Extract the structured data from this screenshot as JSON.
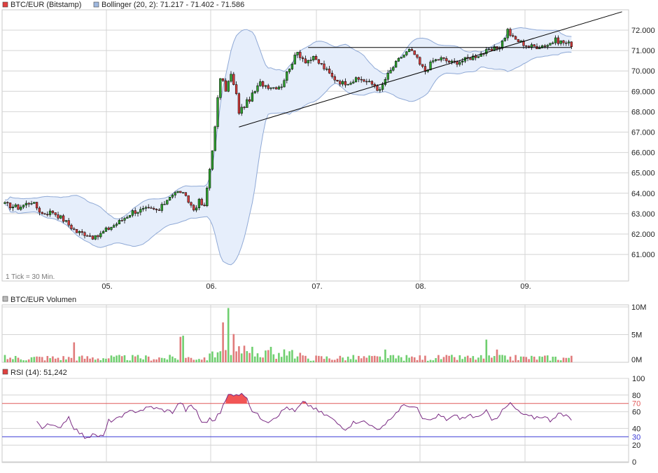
{
  "colors": {
    "price_swatch": "#e0403f",
    "bollinger_swatch": "#9fb8df",
    "bollinger_fill": "#e6eefb",
    "bollinger_line": "#8fa9d6",
    "candle_up": "#2ea02e",
    "candle_down": "#d23b3b",
    "candle_outline": "#000000",
    "volume_swatch": "#bbbbbb",
    "volume_up": "#6fcf6f",
    "volume_down": "#e07b7b",
    "rsi_swatch": "#e0403f",
    "rsi_line": "#7a2a83",
    "rsi_over70": "#f25555",
    "rsi_upper": "#e05a5a",
    "rsi_lower": "#3b3bd6",
    "grid": "#d4d4d4",
    "axis_text": "#222222",
    "trendline": "#000000"
  },
  "price_panel": {
    "legend": [
      {
        "label": "BTC/EUR (Bitstamp)",
        "swatch": "red"
      },
      {
        "label": "Bollinger (20, 2): 71.217 - 71.402 - 71.586",
        "swatch": "blue"
      }
    ],
    "footnote": "1 Tick = 30 Min."
  },
  "volume_panel": {
    "legend": "BTC/EUR Volumen"
  },
  "rsi_panel": {
    "legend": "RSI (14): 51,242"
  },
  "chart_data": [
    {
      "type": "candlestick",
      "title": "BTC/EUR (Bitstamp)",
      "x_ticks": [
        "05.",
        "06.",
        "07.",
        "08.",
        "09."
      ],
      "ylim": [
        60000,
        72700
      ],
      "y_ticks": [
        "61.000",
        "62.000",
        "63.000",
        "64.000",
        "65.000",
        "66.000",
        "67.000",
        "68.000",
        "69.000",
        "70.000",
        "71.000",
        "72.000"
      ],
      "grid": true,
      "close_keypoints": [
        [
          0,
          63450
        ],
        [
          5,
          63300
        ],
        [
          10,
          63600
        ],
        [
          14,
          63000
        ],
        [
          18,
          63100
        ],
        [
          22,
          62700
        ],
        [
          27,
          62100
        ],
        [
          31,
          62000
        ],
        [
          34,
          61800
        ],
        [
          38,
          62200
        ],
        [
          43,
          62600
        ],
        [
          48,
          63100
        ],
        [
          53,
          63200
        ],
        [
          58,
          63150
        ],
        [
          62,
          63900
        ],
        [
          66,
          64100
        ],
        [
          69,
          63600
        ],
        [
          71,
          63200
        ],
        [
          73,
          63600
        ],
        [
          75,
          63300
        ],
        [
          77,
          65200
        ],
        [
          79,
          67200
        ],
        [
          80,
          68600
        ],
        [
          81,
          69700
        ],
        [
          83,
          69100
        ],
        [
          85,
          69800
        ],
        [
          87,
          68800
        ],
        [
          88,
          68000
        ],
        [
          90,
          68300
        ],
        [
          93,
          68800
        ],
        [
          96,
          69400
        ],
        [
          98,
          69300
        ],
        [
          101,
          69200
        ],
        [
          104,
          69300
        ],
        [
          107,
          70200
        ],
        [
          110,
          70900
        ],
        [
          113,
          70500
        ],
        [
          116,
          70600
        ],
        [
          119,
          70300
        ],
        [
          123,
          69700
        ],
        [
          127,
          69400
        ],
        [
          130,
          69500
        ],
        [
          134,
          69600
        ],
        [
          137,
          69400
        ],
        [
          139,
          69300
        ],
        [
          141,
          69000
        ],
        [
          143,
          69600
        ],
        [
          146,
          70200
        ],
        [
          149,
          70700
        ],
        [
          152,
          71000
        ],
        [
          154,
          70800
        ],
        [
          156,
          70300
        ],
        [
          158,
          70000
        ],
        [
          161,
          70500
        ],
        [
          164,
          70600
        ],
        [
          168,
          70400
        ],
        [
          172,
          70500
        ],
        [
          176,
          70700
        ],
        [
          180,
          70900
        ],
        [
          183,
          71000
        ],
        [
          186,
          71200
        ],
        [
          188,
          71700
        ],
        [
          189,
          72000
        ],
        [
          191,
          71600
        ],
        [
          194,
          71400
        ],
        [
          197,
          71200
        ],
        [
          200,
          71200
        ],
        [
          204,
          71300
        ],
        [
          207,
          71500
        ],
        [
          210,
          71400
        ],
        [
          213,
          71300
        ]
      ],
      "series": [
        {
          "name": "BTC/EUR (Bitstamp)",
          "style": "candlestick"
        },
        {
          "name": "Bollinger (20, 2)",
          "values_last": [
            71.217,
            71.402,
            71.586
          ]
        }
      ],
      "annotations": {
        "resistance_line": {
          "y": 71150,
          "x_from": 114,
          "x_to": 213
        },
        "rising_trendline": {
          "from": [
            88,
            67250
          ],
          "to": [
            232,
            72900
          ]
        }
      }
    },
    {
      "type": "bar",
      "title": "BTC/EUR Volumen",
      "ylim": [
        0,
        10000000
      ],
      "y_ticks": [
        "10M",
        "5M",
        "0M"
      ],
      "spikes": [
        [
          26,
          3600000
        ],
        [
          66,
          4600000
        ],
        [
          67,
          4800000
        ],
        [
          82,
          7200000
        ],
        [
          84,
          9800000
        ],
        [
          86,
          5100000
        ],
        [
          88,
          2900000
        ],
        [
          90,
          3000000
        ],
        [
          93,
          2800000
        ],
        [
          99,
          2200000
        ],
        [
          143,
          2300000
        ],
        [
          181,
          4100000
        ],
        [
          185,
          2300000
        ]
      ]
    },
    {
      "type": "line",
      "title": "RSI (14)",
      "last_value": "51,242",
      "ylim": [
        0,
        100
      ],
      "y_ticks": [
        "0",
        "20",
        "40",
        "60",
        "80",
        "100"
      ],
      "bands": {
        "upper": 70,
        "lower": 30
      },
      "band_labels": [
        "70",
        "30"
      ],
      "keypoints": [
        [
          12,
          49
        ],
        [
          14,
          42
        ],
        [
          17,
          44
        ],
        [
          20,
          40
        ],
        [
          24,
          54
        ],
        [
          26,
          41
        ],
        [
          28,
          35
        ],
        [
          30,
          30
        ],
        [
          32,
          31
        ],
        [
          34,
          32
        ],
        [
          37,
          30
        ],
        [
          39,
          49
        ],
        [
          43,
          52
        ],
        [
          47,
          60
        ],
        [
          51,
          62
        ],
        [
          55,
          66
        ],
        [
          58,
          63
        ],
        [
          63,
          60
        ],
        [
          66,
          72
        ],
        [
          68,
          62
        ],
        [
          70,
          67
        ],
        [
          72,
          62
        ],
        [
          74,
          46
        ],
        [
          77,
          51
        ],
        [
          79,
          50
        ],
        [
          81,
          60
        ],
        [
          84,
          80
        ],
        [
          87,
          82
        ],
        [
          90,
          80
        ],
        [
          93,
          62
        ],
        [
          96,
          53
        ],
        [
          99,
          49
        ],
        [
          103,
          57
        ],
        [
          106,
          66
        ],
        [
          109,
          60
        ],
        [
          112,
          71
        ],
        [
          115,
          67
        ],
        [
          118,
          60
        ],
        [
          122,
          54
        ],
        [
          125,
          46
        ],
        [
          128,
          40
        ],
        [
          131,
          47
        ],
        [
          134,
          50
        ],
        [
          137,
          44
        ],
        [
          139,
          43
        ],
        [
          141,
          38
        ],
        [
          143,
          44
        ],
        [
          146,
          55
        ],
        [
          149,
          66
        ],
        [
          152,
          68
        ],
        [
          155,
          63
        ],
        [
          157,
          52
        ],
        [
          160,
          48
        ],
        [
          163,
          56
        ],
        [
          166,
          51
        ],
        [
          169,
          55
        ],
        [
          172,
          52
        ],
        [
          175,
          56
        ],
        [
          178,
          52
        ],
        [
          181,
          60
        ],
        [
          183,
          52
        ],
        [
          185,
          54
        ],
        [
          188,
          64
        ],
        [
          190,
          70
        ],
        [
          193,
          60
        ],
        [
          196,
          55
        ],
        [
          199,
          53
        ],
        [
          202,
          55
        ],
        [
          205,
          50
        ],
        [
          208,
          58
        ],
        [
          211,
          54
        ],
        [
          213,
          51
        ]
      ]
    }
  ]
}
